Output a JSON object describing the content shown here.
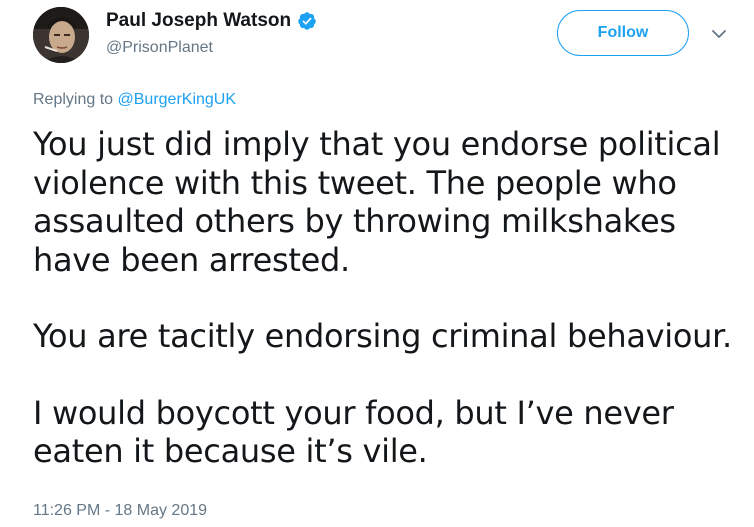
{
  "author": {
    "display_name": "Paul Joseph Watson",
    "handle": "@PrisonPlanet",
    "verified": true
  },
  "follow_label": "Follow",
  "reply_context": {
    "prefix": "Replying to",
    "mention": "@BurgerKingUK"
  },
  "tweet": {
    "paragraphs": [
      "You just did imply that you endorse political violence with this tweet. The people who assaulted others by throwing milkshakes have been arrested.",
      "You are tacitly endorsing criminal behaviour.",
      "I would boycott your food, but I’ve never eaten it because it’s vile."
    ],
    "timestamp": "11:26 PM - 18 May 2019"
  },
  "colors": {
    "accent": "#1da1f2",
    "text": "#14171a",
    "secondary": "#657786"
  },
  "icons": {
    "verified": "verified-badge-icon",
    "caret": "chevron-down-icon"
  }
}
